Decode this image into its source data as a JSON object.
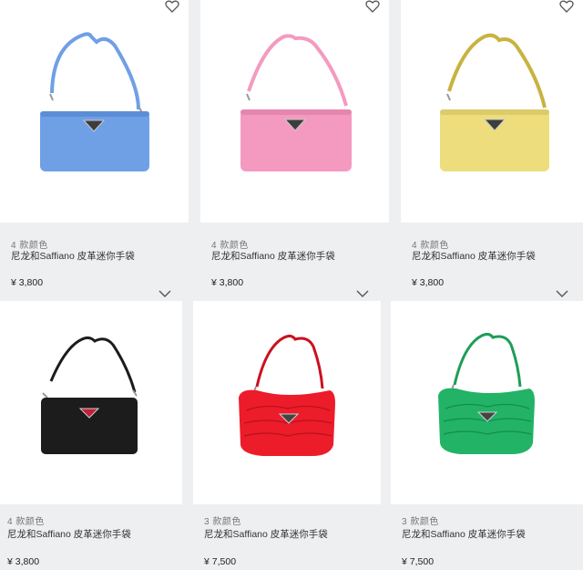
{
  "products": [
    {
      "colors_label": "4 款颜色",
      "name": "尼龙和Saffiano 皮革迷你手袋",
      "price": "¥ 3,800",
      "color": "#6fa0e6",
      "action_icon": "heart-icon"
    },
    {
      "colors_label": "4 款颜色",
      "name": "尼龙和Saffiano 皮革迷你手袋",
      "price": "¥ 3,800",
      "color": "#f49ac0",
      "action_icon": "heart-icon"
    },
    {
      "colors_label": "4 款颜色",
      "name": "尼龙和Saffiano 皮革迷你手袋",
      "price": "¥ 3,800",
      "color": "#eedd7c",
      "action_icon": "heart-icon"
    },
    {
      "colors_label": "4 款颜色",
      "name": "尼龙和Saffiano 皮革迷你手袋",
      "price": "¥ 3,800",
      "color": "#1c1c1c",
      "action_icon": "chevron-down-icon"
    },
    {
      "colors_label": "3 款颜色",
      "name": "尼龙和Saffiano 皮革迷你手袋",
      "price": "¥ 7,500",
      "color": "#ec1c2a",
      "action_icon": "chevron-down-icon"
    },
    {
      "colors_label": "3 款颜色",
      "name": "尼龙和Saffiano 皮革迷你手袋",
      "price": "¥ 7,500",
      "color": "#22b366",
      "action_icon": "chevron-down-icon"
    }
  ]
}
